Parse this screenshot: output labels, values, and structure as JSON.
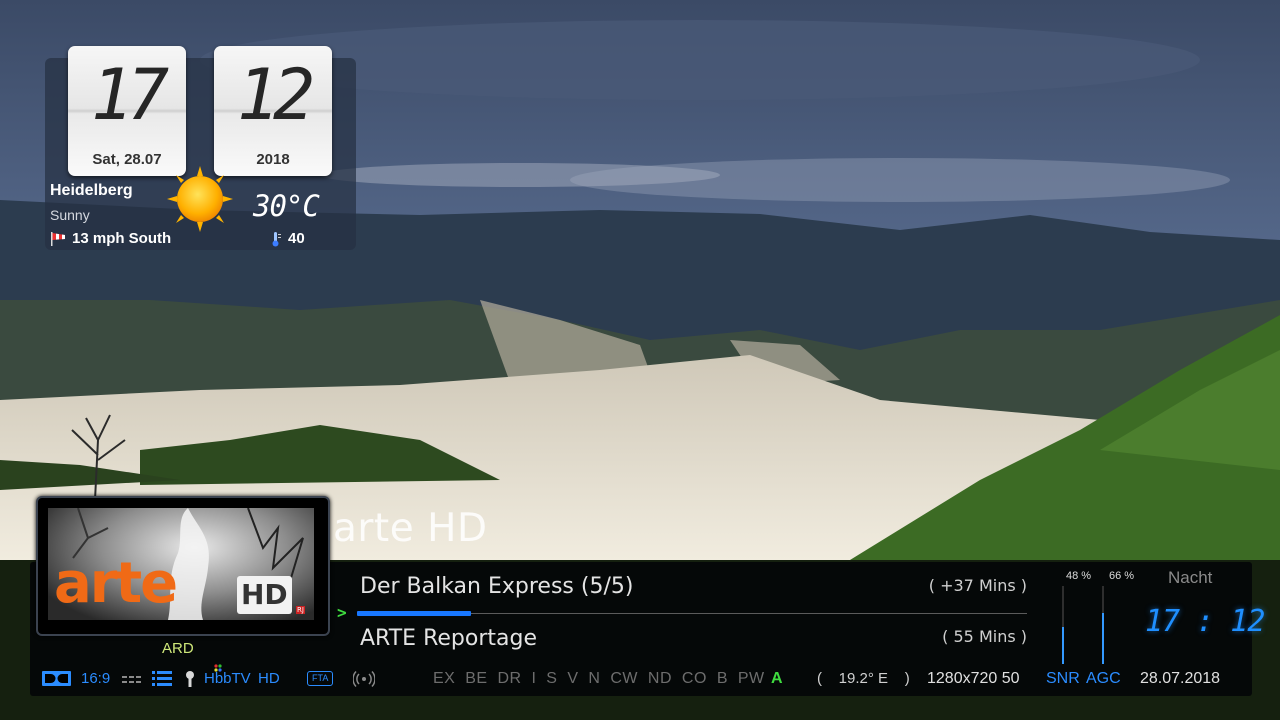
{
  "clock_widget": {
    "hour": "17",
    "minute": "12",
    "date": "Sat, 28.07",
    "year": "2018",
    "city": "Heidelberg",
    "condition": "Sunny",
    "temperature": "30°C",
    "wind": "13 mph South",
    "humidity": "40",
    "weather_icon": "sun-icon"
  },
  "channel": {
    "name": "arte HD",
    "logo_text": "arte",
    "logo_badge": "HD",
    "provider": "ARD"
  },
  "epg": {
    "now_title": "Der Balkan Express (5/5)",
    "now_remaining": "( +37 Mins )",
    "next_title": "ARTE Reportage",
    "next_duration": "( 55 Mins )",
    "progress_fraction": 0.17
  },
  "signal": {
    "snr_percent_label": "48 %",
    "agc_percent_label": "66 %",
    "snr_level": 0.48,
    "agc_level": 0.66,
    "snr_label": "SNR",
    "agc_label": "AGC"
  },
  "time_panel": {
    "period": "Nacht",
    "time": "17 : 12",
    "date": "28.07.2018"
  },
  "status": {
    "aspect": "16:9",
    "hbbtv": "HbbTV",
    "hd": "HD",
    "fta": "FTA",
    "ca_systems": "EX  BE  DR  I  S  V  N  CW  ND  CO  B  PW",
    "tuner": "A",
    "orbital": "(    19.2° E    )",
    "resolution": "1280x720 50"
  },
  "colors": {
    "accent_blue": "#2b8cff",
    "logo_orange": "#f06a16",
    "tuner_green": "#3fdc3f",
    "provider_green": "#cfe87a"
  }
}
